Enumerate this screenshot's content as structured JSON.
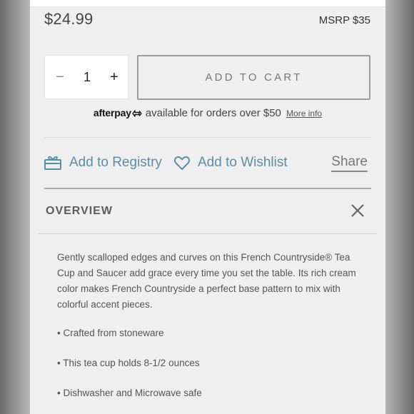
{
  "product": {
    "price": "$24.99",
    "msrp": "MSRP $35"
  },
  "quantity": {
    "minus_label": "−",
    "value": "1",
    "plus_label": "+"
  },
  "cart": {
    "add_label": "ADD TO CART"
  },
  "afterpay": {
    "logo_text": "afterpay",
    "message": "available for orders over $50",
    "more_info": "More info"
  },
  "actions": {
    "registry": "Add to Registry",
    "wishlist": "Add to Wishlist",
    "share": "Share"
  },
  "overview": {
    "title": "OVERVIEW",
    "description": "Gently scalloped edges and curves on this French Countryside® Tea Cup and Saucer add grace every time you set the table. Its rich cream color makes French Countryside a perfect base pattern to mix with colorful accent pieces.",
    "bullets": [
      "• Crafted from stoneware",
      "• This tea cup holds 8-1/2 ounces",
      "• Dishwasher and Microwave safe"
    ]
  },
  "icons": {
    "registry": "gift-icon",
    "wishlist": "heart-icon",
    "close": "close-icon",
    "afterpay": "afterpay-arrows-icon"
  },
  "colors": {
    "link_blue": "#5b8ea6",
    "panel_bg": "#efefef"
  }
}
